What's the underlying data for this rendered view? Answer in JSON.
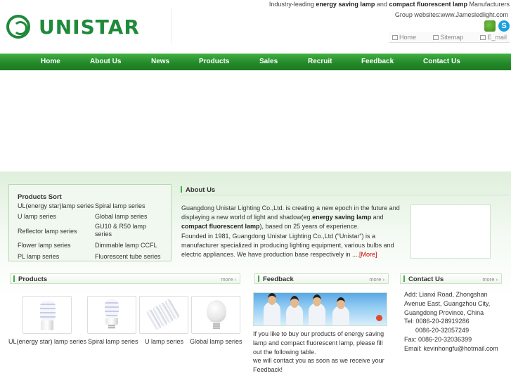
{
  "header": {
    "logo_text": "UNISTAR",
    "tagline": {
      "pre": "Industry-leading ",
      "bold1": "energy saving lamp",
      "mid": " and ",
      "bold2": "compact fluorescent lamp",
      "post": " Manufacturers"
    },
    "group_sites": "Group websites:www.Jamesledlight.com",
    "icons": [
      "msn-icon",
      "skype-icon"
    ],
    "quick_links": [
      "Home",
      "Sitemap",
      "E_mail"
    ]
  },
  "nav": {
    "items": [
      "Home",
      "About Us",
      "News",
      "Products",
      "Sales",
      "Recruit",
      "Feedback",
      "Contact Us"
    ]
  },
  "sort": {
    "title": "Products Sort",
    "links": [
      "UL(energy star)lamp series",
      "Spiral lamp series",
      "U lamp series",
      "Global lamp series",
      "Reflector lamp series",
      "GU10 & R50 lamp series",
      "Flower lamp series",
      "Dimmable lamp CCFL",
      "PL lamp series",
      "Fluorescent tube series"
    ]
  },
  "about": {
    "title": "About Us",
    "p1_pre": "Guangdong Unistar Lighting Co.,Ltd. is creating a new epoch in the future and displaying a new world of light and shadow(eg.",
    "p1_b1": "energy saving lamp",
    "p1_mid": " and ",
    "p1_b2": "compact fluorescent lamp",
    "p1_post": "), based on 25 years of experience.",
    "p2": "Founded in 1981, Guangdong Unistar Lighting Co.,Ltd (\"Unistar\") is a manufacturer specialized in producing lighting equipment, various bulbs and electric appliances. We have production base respectively in ....",
    "more": "[More]"
  },
  "products": {
    "title": "Products",
    "more": "more",
    "items": [
      "UL(energy star) lamp series",
      "Spiral lamp series",
      "U lamp series",
      "Global lamp series"
    ]
  },
  "feedback": {
    "title": "Feedback",
    "more": "more",
    "text1": "If you like to buy our products of energy saving lamp and compact fluorescent lamp, please fill out the following table.",
    "text2": "we will contact you as soon as we receive your Feedback!"
  },
  "contact": {
    "title": "Contact Us",
    "more": "more",
    "add_label": "Add: Lianxi Road, Zhongshan",
    "add_line2": "Avenue East, Guangzhou City,",
    "add_line3": "Guangdong Province, China",
    "tel_label": "Tel: 0086-20-28919286",
    "tel2": "0086-20-32057249",
    "fax": "Fax: 0086-20-32036399",
    "email": "Email: kevinhongfu@hotmail.com"
  }
}
